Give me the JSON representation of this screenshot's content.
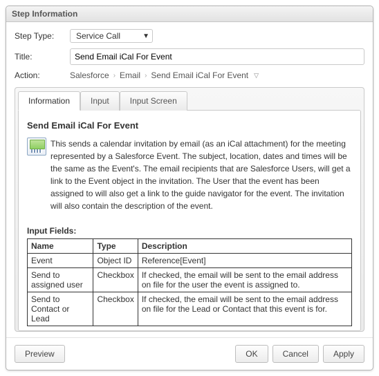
{
  "panel": {
    "title": "Step Information"
  },
  "form": {
    "step_type_label": "Step Type:",
    "step_type_value": "Service Call",
    "title_label": "Title:",
    "title_value": "Send Email iCal For Event",
    "action_label": "Action:",
    "action_crumbs": [
      "Salesforce",
      "Email",
      "Send Email iCal For Event"
    ]
  },
  "tabs": {
    "information": "Information",
    "input": "Input",
    "input_screen": "Input Screen"
  },
  "content": {
    "heading": "Send Email iCal For Event",
    "description": "This sends a calendar invitation by email (as an iCal attachment) for the meeting represented by a Salesforce Event. The subject, location, dates and times will be the same as the Event's. The email recipients that are Salesforce Users, will get a link to the Event object in the invitation. The User that the event has been assigned to will also get a link to the guide navigator for the event. The invitation will also contain the description of the event.",
    "input_fields_title": "Input Fields:",
    "table": {
      "headers": {
        "name": "Name",
        "type": "Type",
        "description": "Description"
      },
      "rows": [
        {
          "name": "Event",
          "type": "Object ID",
          "description": "Reference[Event]"
        },
        {
          "name": "Send to assigned user",
          "type": "Checkbox",
          "description": "If checked, the email will be sent to the email address on file for the user the event is assigned to."
        },
        {
          "name": "Send to Contact or Lead",
          "type": "Checkbox",
          "description": "If checked, the email will be sent to the email address on file for the Lead or Contact that this event is for."
        }
      ]
    }
  },
  "buttons": {
    "preview": "Preview",
    "ok": "OK",
    "cancel": "Cancel",
    "apply": "Apply"
  }
}
